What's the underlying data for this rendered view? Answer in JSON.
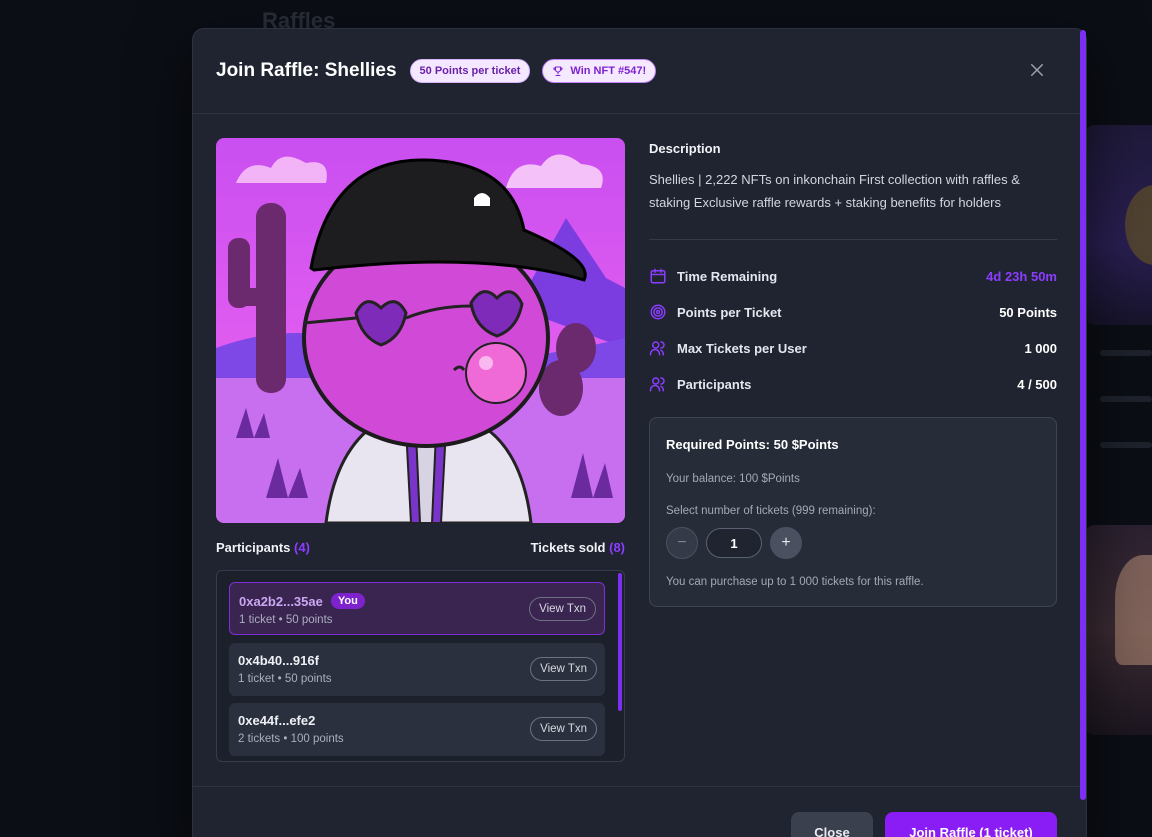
{
  "background": {
    "title": "Raffles"
  },
  "modal": {
    "title": "Join Raffle: Shellies",
    "points_badge": "50 Points per ticket",
    "win_badge": "Win NFT #547!"
  },
  "participants_section": {
    "label": "Participants",
    "count": "(4)",
    "tickets_label": "Tickets sold",
    "tickets_count": "(8)",
    "rows": [
      {
        "address": "0xa2b2...35ae",
        "badge": "You",
        "detail": "1 ticket • 50 points",
        "action": "View Txn"
      },
      {
        "address": "0x4b40...916f",
        "detail": "1 ticket • 50 points",
        "action": "View Txn"
      },
      {
        "address": "0xe44f...efe2",
        "detail": "2 tickets • 100 points",
        "action": "View Txn"
      }
    ]
  },
  "description": {
    "heading": "Description",
    "text": "Shellies | 2,222 NFTs on inkonchain First collection with raffles & staking Exclusive raffle rewards + staking benefits for holders"
  },
  "stats": [
    {
      "icon": "calendar-icon",
      "label": "Time Remaining",
      "value": "4d 23h 50m"
    },
    {
      "icon": "target-icon",
      "label": "Points per Ticket",
      "value": "50 Points"
    },
    {
      "icon": "users-icon",
      "label": "Max Tickets per User",
      "value": "1 000"
    },
    {
      "icon": "users-icon",
      "label": "Participants",
      "value": "4 / 500"
    }
  ],
  "purchase": {
    "required": "Required Points: 50 $Points",
    "balance": "Your balance: 100 $Points",
    "select_label": "Select number of tickets (999 remaining):",
    "quantity": "1",
    "minus": "−",
    "plus": "+",
    "note": "You can purchase up to 1 000 tickets for this raffle."
  },
  "footer": {
    "close_label": "Close",
    "join_label": "Join Raffle (1 ticket)"
  },
  "colors": {
    "accent": "#8a1cf5",
    "modal_bg": "#1f2430",
    "page_bg": "#0b0e15"
  }
}
